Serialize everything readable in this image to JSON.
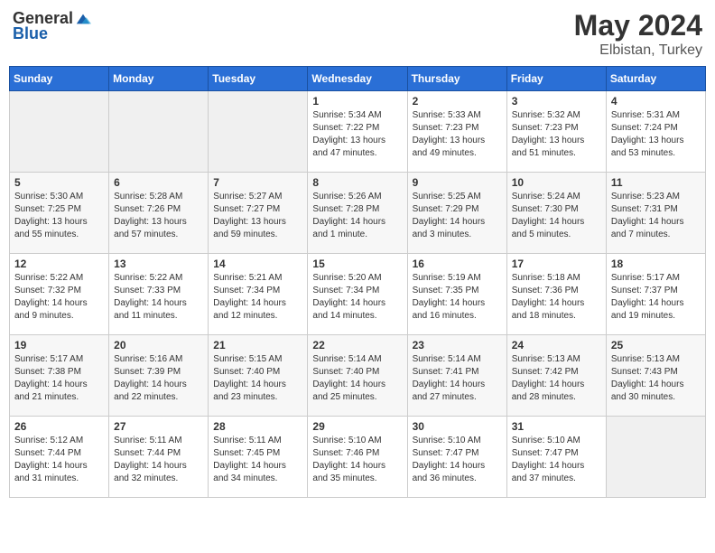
{
  "header": {
    "logo": {
      "general": "General",
      "blue": "Blue"
    },
    "month": "May 2024",
    "location": "Elbistan, Turkey"
  },
  "weekdays": [
    "Sunday",
    "Monday",
    "Tuesday",
    "Wednesday",
    "Thursday",
    "Friday",
    "Saturday"
  ],
  "weeks": [
    [
      {
        "day": "",
        "info": ""
      },
      {
        "day": "",
        "info": ""
      },
      {
        "day": "",
        "info": ""
      },
      {
        "day": "1",
        "info": "Sunrise: 5:34 AM\nSunset: 7:22 PM\nDaylight: 13 hours\nand 47 minutes."
      },
      {
        "day": "2",
        "info": "Sunrise: 5:33 AM\nSunset: 7:23 PM\nDaylight: 13 hours\nand 49 minutes."
      },
      {
        "day": "3",
        "info": "Sunrise: 5:32 AM\nSunset: 7:23 PM\nDaylight: 13 hours\nand 51 minutes."
      },
      {
        "day": "4",
        "info": "Sunrise: 5:31 AM\nSunset: 7:24 PM\nDaylight: 13 hours\nand 53 minutes."
      }
    ],
    [
      {
        "day": "5",
        "info": "Sunrise: 5:30 AM\nSunset: 7:25 PM\nDaylight: 13 hours\nand 55 minutes."
      },
      {
        "day": "6",
        "info": "Sunrise: 5:28 AM\nSunset: 7:26 PM\nDaylight: 13 hours\nand 57 minutes."
      },
      {
        "day": "7",
        "info": "Sunrise: 5:27 AM\nSunset: 7:27 PM\nDaylight: 13 hours\nand 59 minutes."
      },
      {
        "day": "8",
        "info": "Sunrise: 5:26 AM\nSunset: 7:28 PM\nDaylight: 14 hours\nand 1 minute."
      },
      {
        "day": "9",
        "info": "Sunrise: 5:25 AM\nSunset: 7:29 PM\nDaylight: 14 hours\nand 3 minutes."
      },
      {
        "day": "10",
        "info": "Sunrise: 5:24 AM\nSunset: 7:30 PM\nDaylight: 14 hours\nand 5 minutes."
      },
      {
        "day": "11",
        "info": "Sunrise: 5:23 AM\nSunset: 7:31 PM\nDaylight: 14 hours\nand 7 minutes."
      }
    ],
    [
      {
        "day": "12",
        "info": "Sunrise: 5:22 AM\nSunset: 7:32 PM\nDaylight: 14 hours\nand 9 minutes."
      },
      {
        "day": "13",
        "info": "Sunrise: 5:22 AM\nSunset: 7:33 PM\nDaylight: 14 hours\nand 11 minutes."
      },
      {
        "day": "14",
        "info": "Sunrise: 5:21 AM\nSunset: 7:34 PM\nDaylight: 14 hours\nand 12 minutes."
      },
      {
        "day": "15",
        "info": "Sunrise: 5:20 AM\nSunset: 7:34 PM\nDaylight: 14 hours\nand 14 minutes."
      },
      {
        "day": "16",
        "info": "Sunrise: 5:19 AM\nSunset: 7:35 PM\nDaylight: 14 hours\nand 16 minutes."
      },
      {
        "day": "17",
        "info": "Sunrise: 5:18 AM\nSunset: 7:36 PM\nDaylight: 14 hours\nand 18 minutes."
      },
      {
        "day": "18",
        "info": "Sunrise: 5:17 AM\nSunset: 7:37 PM\nDaylight: 14 hours\nand 19 minutes."
      }
    ],
    [
      {
        "day": "19",
        "info": "Sunrise: 5:17 AM\nSunset: 7:38 PM\nDaylight: 14 hours\nand 21 minutes."
      },
      {
        "day": "20",
        "info": "Sunrise: 5:16 AM\nSunset: 7:39 PM\nDaylight: 14 hours\nand 22 minutes."
      },
      {
        "day": "21",
        "info": "Sunrise: 5:15 AM\nSunset: 7:40 PM\nDaylight: 14 hours\nand 23 minutes."
      },
      {
        "day": "22",
        "info": "Sunrise: 5:14 AM\nSunset: 7:40 PM\nDaylight: 14 hours\nand 25 minutes."
      },
      {
        "day": "23",
        "info": "Sunrise: 5:14 AM\nSunset: 7:41 PM\nDaylight: 14 hours\nand 27 minutes."
      },
      {
        "day": "24",
        "info": "Sunrise: 5:13 AM\nSunset: 7:42 PM\nDaylight: 14 hours\nand 28 minutes."
      },
      {
        "day": "25",
        "info": "Sunrise: 5:13 AM\nSunset: 7:43 PM\nDaylight: 14 hours\nand 30 minutes."
      }
    ],
    [
      {
        "day": "26",
        "info": "Sunrise: 5:12 AM\nSunset: 7:44 PM\nDaylight: 14 hours\nand 31 minutes."
      },
      {
        "day": "27",
        "info": "Sunrise: 5:11 AM\nSunset: 7:44 PM\nDaylight: 14 hours\nand 32 minutes."
      },
      {
        "day": "28",
        "info": "Sunrise: 5:11 AM\nSunset: 7:45 PM\nDaylight: 14 hours\nand 34 minutes."
      },
      {
        "day": "29",
        "info": "Sunrise: 5:10 AM\nSunset: 7:46 PM\nDaylight: 14 hours\nand 35 minutes."
      },
      {
        "day": "30",
        "info": "Sunrise: 5:10 AM\nSunset: 7:47 PM\nDaylight: 14 hours\nand 36 minutes."
      },
      {
        "day": "31",
        "info": "Sunrise: 5:10 AM\nSunset: 7:47 PM\nDaylight: 14 hours\nand 37 minutes."
      },
      {
        "day": "",
        "info": ""
      }
    ]
  ]
}
